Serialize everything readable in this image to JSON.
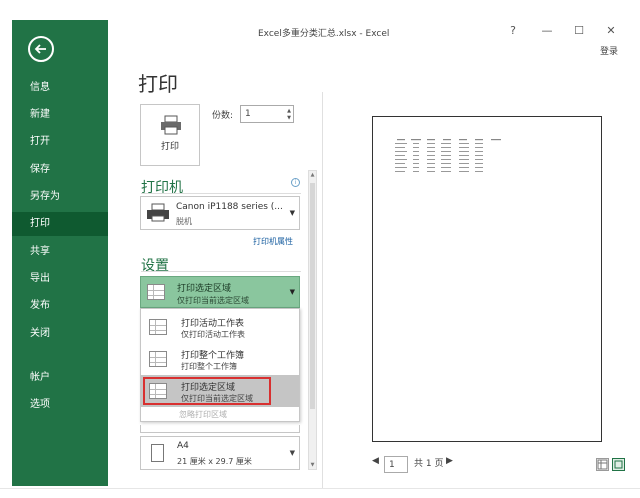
{
  "app": {
    "title": "Excel多重分类汇总.xlsx - Excel",
    "login": "登录",
    "window_controls": [
      "?",
      "—",
      "☐",
      "✕"
    ]
  },
  "sidebar": {
    "items": [
      {
        "label": "信息"
      },
      {
        "label": "新建"
      },
      {
        "label": "打开"
      },
      {
        "label": "保存"
      },
      {
        "label": "另存为"
      },
      {
        "label": "打印",
        "active": true
      },
      {
        "label": "共享"
      },
      {
        "label": "导出"
      },
      {
        "label": "发布"
      },
      {
        "label": "关闭"
      },
      {
        "label": "帐户"
      },
      {
        "label": "选项"
      }
    ]
  },
  "print": {
    "page_title": "打印",
    "print_button": "打印",
    "copies_label": "份数:",
    "copies_value": "1"
  },
  "printer": {
    "section_title": "打印机",
    "name": "Canon iP1188 series (...",
    "status": "脱机",
    "properties_link": "打印机属性"
  },
  "settings": {
    "section_title": "设置",
    "selected": {
      "title": "打印选定区域",
      "desc": "仅打印当前选定区域"
    },
    "options": [
      {
        "title": "打印活动工作表",
        "desc": "仅打印活动工作表"
      },
      {
        "title": "打印整个工作簿",
        "desc": "打印整个工作簿"
      },
      {
        "title": "打印选定区域",
        "desc": "仅打印当前选定区域",
        "highlighted": true
      }
    ],
    "ignore_area": "忽略打印区域",
    "paper": {
      "name": "A4",
      "dimensions": "21 厘米 x 29.7 厘米"
    }
  },
  "preview": {
    "current_page": "1",
    "total_pages": "共 1 页",
    "prev_arrow": "◀",
    "next_arrow": "▶"
  },
  "colors": {
    "accent": "#217346",
    "highlight_frame": "#d83030",
    "selected_option": "#8ac69e"
  }
}
